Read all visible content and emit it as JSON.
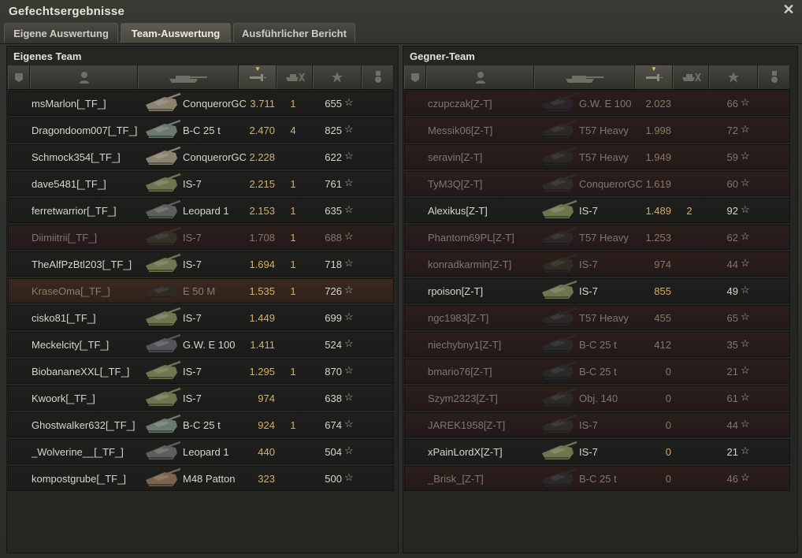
{
  "window": {
    "title": "Gefechtsergebnisse"
  },
  "tabs": [
    {
      "label": "Eigene Auswertung"
    },
    {
      "label": "Team-Auswertung"
    },
    {
      "label": "Ausführlicher Bericht"
    }
  ],
  "own_team": {
    "title": "Eigenes Team",
    "rows": [
      {
        "player": "msMarlon[_TF_]",
        "tank": "ConquerorGC",
        "damage": "3.711",
        "kills": "1",
        "xp": "655",
        "state": "alive",
        "tank_color": "#8a8370"
      },
      {
        "player": "Dragondoom007[_TF_]",
        "tank": "B-C 25 t",
        "damage": "2.470",
        "kills": "4",
        "xp": "825",
        "state": "alive",
        "tank_color": "#6a7a6e"
      },
      {
        "player": "Schmock354[_TF_]",
        "tank": "ConquerorGC",
        "damage": "2.228",
        "kills": "",
        "xp": "622",
        "state": "alive",
        "tank_color": "#8a8370"
      },
      {
        "player": "dave5481[_TF_]",
        "tank": "IS-7",
        "damage": "2.215",
        "kills": "1",
        "xp": "761",
        "state": "alive",
        "tank_color": "#6e7650"
      },
      {
        "player": "ferretwarrior[_TF_]",
        "tank": "Leopard 1",
        "damage": "2.153",
        "kills": "1",
        "xp": "635",
        "state": "alive",
        "tank_color": "#5e5e5a"
      },
      {
        "player": "Diimiitrii[_TF_]",
        "tank": "IS-7",
        "damage": "1.708",
        "kills": "1",
        "xp": "688",
        "state": "dead",
        "tank_color": "#3e4434"
      },
      {
        "player": "TheAlfPzBtl203[_TF_]",
        "tank": "IS-7",
        "damage": "1.694",
        "kills": "1",
        "xp": "718",
        "state": "alive",
        "tank_color": "#6e7650"
      },
      {
        "player": "KraseOma[_TF_]",
        "tank": "E 50 M",
        "damage": "1.535",
        "kills": "1",
        "xp": "726",
        "state": "tk",
        "tank_color": "#2e2e2e"
      },
      {
        "player": "cisko81[_TF_]",
        "tank": "IS-7",
        "damage": "1.449",
        "kills": "",
        "xp": "699",
        "state": "alive",
        "tank_color": "#6e7650"
      },
      {
        "player": "Meckelcity[_TF_]",
        "tank": "G.W. E 100",
        "damage": "1.411",
        "kills": "",
        "xp": "524",
        "state": "alive",
        "tank_color": "#54545a"
      },
      {
        "player": "BiobananeXXL[_TF_]",
        "tank": "IS-7",
        "damage": "1.295",
        "kills": "1",
        "xp": "870",
        "state": "alive",
        "tank_color": "#6e7650"
      },
      {
        "player": "Kwoork[_TF_]",
        "tank": "IS-7",
        "damage": "974",
        "kills": "",
        "xp": "638",
        "state": "alive",
        "tank_color": "#6e7650"
      },
      {
        "player": "Ghostwalker632[_TF_]",
        "tank": "B-C 25 t",
        "damage": "924",
        "kills": "1",
        "xp": "674",
        "state": "alive",
        "tank_color": "#6a7a6e"
      },
      {
        "player": "_Wolverine__[_TF_]",
        "tank": "Leopard 1",
        "damage": "440",
        "kills": "",
        "xp": "504",
        "state": "alive",
        "tank_color": "#5e5e5a"
      },
      {
        "player": "kompostgrube[_TF_]",
        "tank": "M48 Patton",
        "damage": "323",
        "kills": "",
        "xp": "500",
        "state": "alive",
        "tank_color": "#7a6450"
      }
    ]
  },
  "enemy_team": {
    "title": "Gegner-Team",
    "rows": [
      {
        "player": "czupczak[Z-T]",
        "tank": "G.W. E 100",
        "damage": "2.023",
        "kills": "",
        "xp": "66",
        "state": "dead",
        "tank_color": "#2a3038"
      },
      {
        "player": "Messik06[Z-T]",
        "tank": "T57 Heavy",
        "damage": "1.998",
        "kills": "",
        "xp": "72",
        "state": "dead",
        "tank_color": "#2e3230"
      },
      {
        "player": "seravin[Z-T]",
        "tank": "T57 Heavy",
        "damage": "1.949",
        "kills": "",
        "xp": "59",
        "state": "dead",
        "tank_color": "#2e3230"
      },
      {
        "player": "TyM3Q[Z-T]",
        "tank": "ConquerorGC",
        "damage": "1.619",
        "kills": "",
        "xp": "60",
        "state": "dead",
        "tank_color": "#3a3a36"
      },
      {
        "player": "Alexikus[Z-T]",
        "tank": "IS-7",
        "damage": "1.489",
        "kills": "2",
        "xp": "92",
        "state": "alive",
        "tank_color": "#6e7650"
      },
      {
        "player": "Phantom69PL[Z-T]",
        "tank": "T57 Heavy",
        "damage": "1.253",
        "kills": "",
        "xp": "62",
        "state": "dead",
        "tank_color": "#2e3230"
      },
      {
        "player": "konradkarmin[Z-T]",
        "tank": "IS-7",
        "damage": "974",
        "kills": "",
        "xp": "44",
        "state": "dead",
        "tank_color": "#353a2c"
      },
      {
        "player": "rpoison[Z-T]",
        "tank": "IS-7",
        "damage": "855",
        "kills": "",
        "xp": "49",
        "state": "alive",
        "tank_color": "#6e7650"
      },
      {
        "player": "ngc1983[Z-T]",
        "tank": "T57 Heavy",
        "damage": "455",
        "kills": "",
        "xp": "65",
        "state": "dead",
        "tank_color": "#2e3230"
      },
      {
        "player": "niechybny1[Z-T]",
        "tank": "B-C 25 t",
        "damage": "412",
        "kills": "",
        "xp": "35",
        "state": "dead",
        "tank_color": "#2c3638"
      },
      {
        "player": "bmario76[Z-T]",
        "tank": "B-C 25 t",
        "damage": "0",
        "kills": "",
        "xp": "21",
        "state": "dead",
        "tank_color": "#2c3638"
      },
      {
        "player": "Szym2323[Z-T]",
        "tank": "Obj. 140",
        "damage": "0",
        "kills": "",
        "xp": "61",
        "state": "dead",
        "tank_color": "#30362c"
      },
      {
        "player": "JAREK1958[Z-T]",
        "tank": "IS-7",
        "damage": "0",
        "kills": "",
        "xp": "44",
        "state": "dead",
        "tank_color": "#353a2c"
      },
      {
        "player": "xPainLordX[Z-T]",
        "tank": "IS-7",
        "damage": "0",
        "kills": "",
        "xp": "21",
        "state": "alive",
        "tank_color": "#6e7650"
      },
      {
        "player": "_Brisk_[Z-T]",
        "tank": "B-C 25 t",
        "damage": "0",
        "kills": "",
        "xp": "46",
        "state": "dead",
        "tank_color": "#2c3638"
      }
    ]
  },
  "header_icons": [
    "squad-icon",
    "player-icon",
    "tank-icon",
    "damage-icon",
    "kills-icon",
    "xp-icon",
    "medal-icon"
  ],
  "colors": {
    "damage": "#d8b05a",
    "dead_row": "#2b1e1b",
    "alive_row": "#1f1f1d"
  }
}
